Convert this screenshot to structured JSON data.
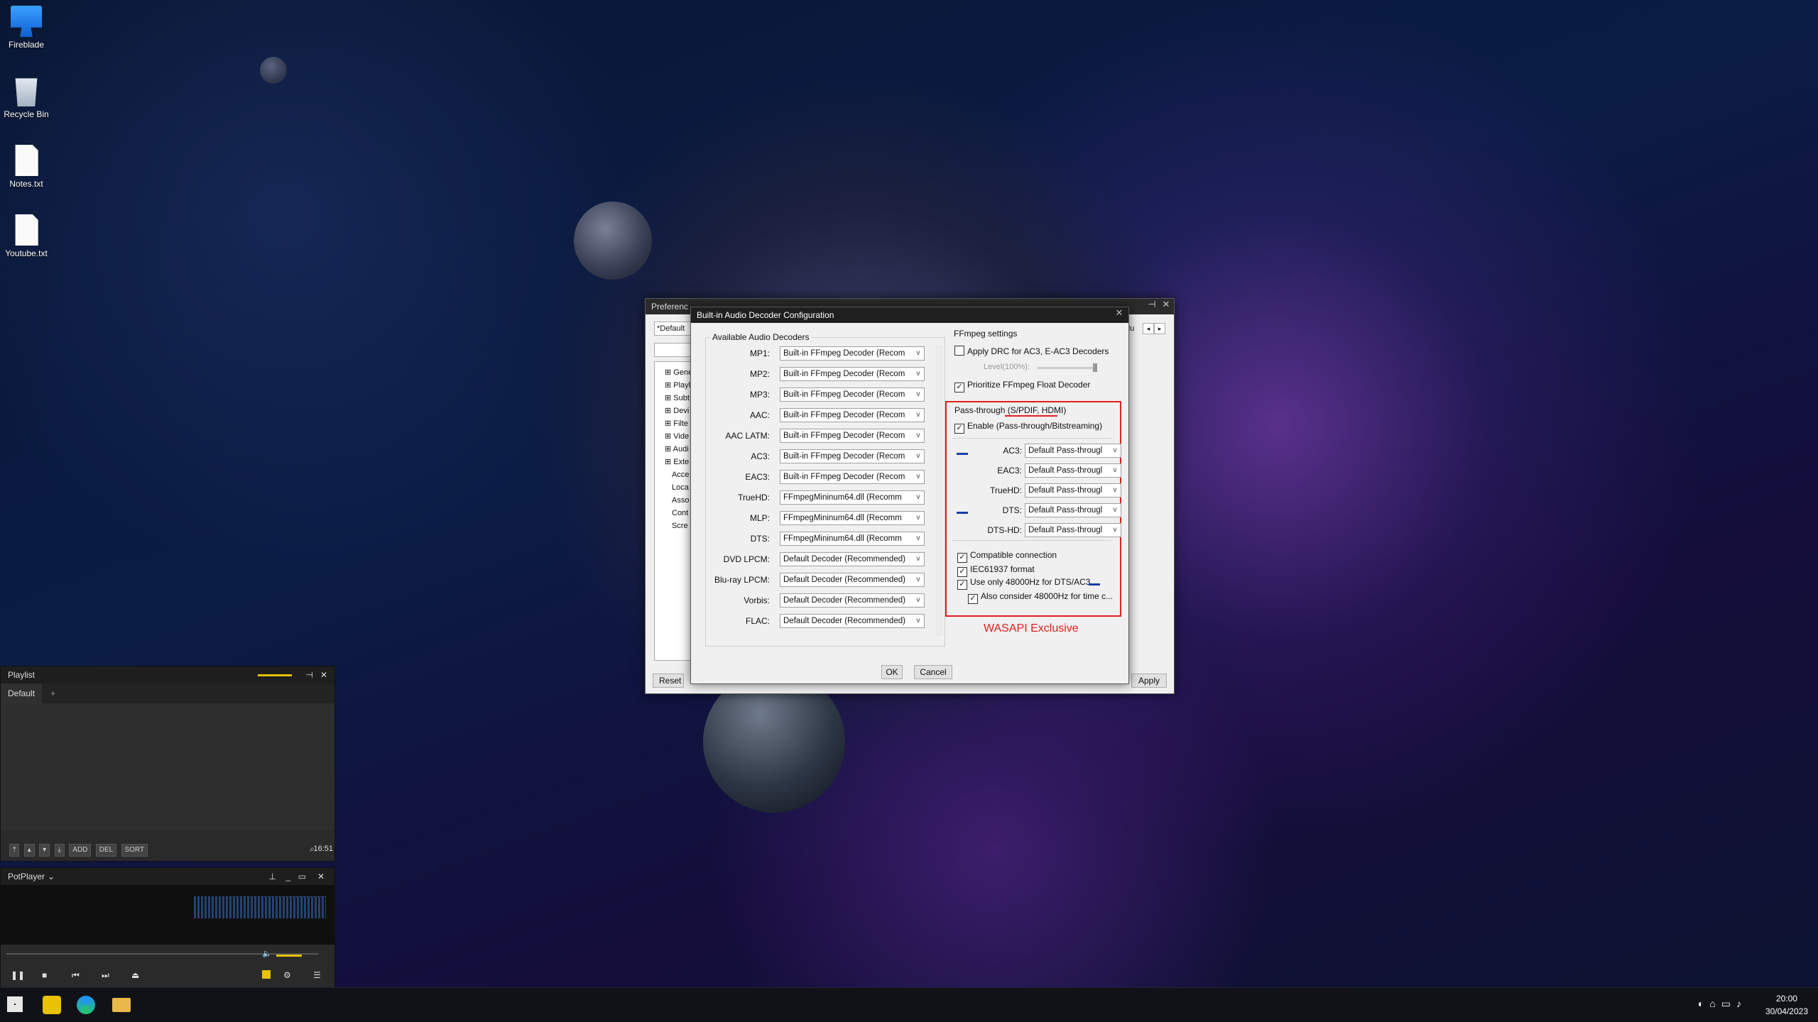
{
  "desktop": {
    "icons": [
      {
        "label": "Fireblade",
        "icon": "computer-icon"
      },
      {
        "label": "Recycle Bin",
        "icon": "recycle-bin-icon"
      },
      {
        "label": "Notes.txt",
        "icon": "text-file-icon"
      },
      {
        "label": "Youtube.txt",
        "icon": "text-file-icon"
      }
    ]
  },
  "preferences": {
    "title": "Preferenc",
    "profile_value": "*Default",
    "tree_items": [
      "Gene",
      "Playl",
      "Subt",
      "Devi",
      "Filte",
      "Vide",
      "Audi",
      "Exte",
      "Acce",
      "Loca",
      "Asso",
      "Cont",
      "Scre"
    ],
    "reset_label": "Reset",
    "apply_label": "Apply",
    "clipped_label": "du"
  },
  "dialog": {
    "title": "Built-in Audio Decoder Configuration",
    "available_group_label": "Available Audio Decoders",
    "decoders": [
      {
        "label": "MP1:",
        "value": "Built-in FFmpeg Decoder (Recom"
      },
      {
        "label": "MP2:",
        "value": "Built-in FFmpeg Decoder (Recom"
      },
      {
        "label": "MP3:",
        "value": "Built-in FFmpeg Decoder (Recom"
      },
      {
        "label": "AAC:",
        "value": "Built-in FFmpeg Decoder (Recom"
      },
      {
        "label": "AAC LATM:",
        "value": "Built-in FFmpeg Decoder (Recom"
      },
      {
        "label": "AC3:",
        "value": "Built-in FFmpeg Decoder (Recom"
      },
      {
        "label": "EAC3:",
        "value": "Built-in FFmpeg Decoder (Recom"
      },
      {
        "label": "TrueHD:",
        "value": "FFmpegMininum64.dll (Recomm"
      },
      {
        "label": "MLP:",
        "value": "FFmpegMininum64.dll (Recomm"
      },
      {
        "label": "DTS:",
        "value": "FFmpegMininum64.dll (Recomm"
      },
      {
        "label": "DVD LPCM:",
        "value": "Default Decoder (Recommended)"
      },
      {
        "label": "Blu-ray LPCM:",
        "value": "Default Decoder (Recommended)"
      },
      {
        "label": "Vorbis:",
        "value": "Default Decoder (Recommended)"
      },
      {
        "label": "FLAC:",
        "value": "Default Decoder (Recommended)"
      }
    ],
    "ffmpeg_group_label": "FFmpeg settings",
    "apply_drc_label": "Apply DRC for AC3, E-AC3 Decoders",
    "level_label": "Level(100%):",
    "prioritize_float_label": "Prioritize FFmpeg Float Decoder",
    "passthrough_group_label": "Pass-through (S/PDIF, HDMI)",
    "enable_passthrough_label": "Enable (Pass-through/Bitstreaming)",
    "passthrough_rows": [
      {
        "label": "AC3:",
        "value": "Default Pass-througl"
      },
      {
        "label": "EAC3:",
        "value": "Default Pass-througl"
      },
      {
        "label": "TrueHD:",
        "value": "Default Pass-througl"
      },
      {
        "label": "DTS:",
        "value": "Default Pass-througl"
      },
      {
        "label": "DTS-HD:",
        "value": "Default Pass-througl"
      }
    ],
    "compatible_connection_label": "Compatible connection",
    "iec_label": "IEC61937 format",
    "use_48k_label": "Use only 48000Hz for DTS/AC3",
    "also_consider_label": "Also consider 48000Hz for time c...",
    "annotation": "WASAPI Exclusive",
    "ok_label": "OK",
    "cancel_label": "Cancel",
    "dropdown_arrow": "v"
  },
  "playlist": {
    "title": "Playlist",
    "tab_default": "Default",
    "tab_add": "+",
    "btn_add": "ADD",
    "btn_del": "DEL",
    "btn_sort": "SORT",
    "time": "16:51"
  },
  "potplayer": {
    "title": "PotPlayer"
  },
  "taskbar": {
    "time": "20:00",
    "date": "30/04/2023"
  },
  "colors": {
    "annotation_red": "#e0201c",
    "blue_mark": "#1b3fa8"
  }
}
